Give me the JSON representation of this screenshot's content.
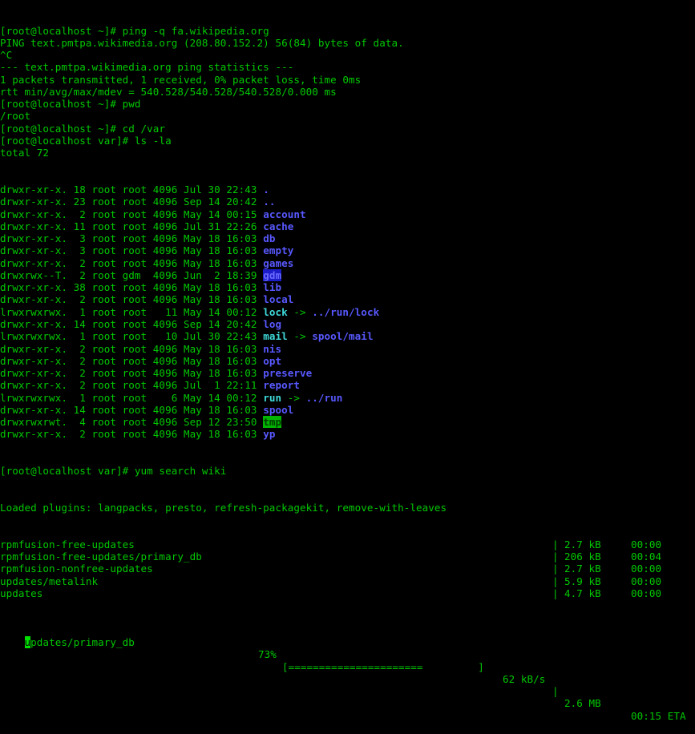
{
  "colors": {
    "background": "#000000",
    "text": "#00c800",
    "directory": "#5858ff",
    "symlink": "#3fd8d8",
    "sticky_dir_bg": "#00b400",
    "other_writable_bg": "#1c1cc8"
  },
  "history": [
    "[root@localhost ~]# ping -q fa.wikipedia.org",
    "PING text.pmtpa.wikimedia.org (208.80.152.2) 56(84) bytes of data.",
    "^C",
    "--- text.pmtpa.wikimedia.org ping statistics ---",
    "1 packets transmitted, 1 received, 0% packet loss, time 0ms",
    "rtt min/avg/max/mdev = 540.528/540.528/540.528/0.000 ms",
    "[root@localhost ~]# pwd",
    "/root",
    "[root@localhost ~]# cd /var",
    "[root@localhost var]# ls -la",
    "total 72"
  ],
  "listing": [
    {
      "meta": "drwxr-xr-x. 18 root root 4096 Jul 30 22:43 ",
      "name": ".",
      "type": "dir"
    },
    {
      "meta": "drwxr-xr-x. 23 root root 4096 Sep 14 20:42 ",
      "name": "..",
      "type": "dir"
    },
    {
      "meta": "drwxr-xr-x.  2 root root 4096 May 14 00:15 ",
      "name": "account",
      "type": "dir"
    },
    {
      "meta": "drwxr-xr-x. 11 root root 4096 Jul 31 22:26 ",
      "name": "cache",
      "type": "dir"
    },
    {
      "meta": "drwxr-xr-x.  3 root root 4096 May 18 16:03 ",
      "name": "db",
      "type": "dir"
    },
    {
      "meta": "drwxr-xr-x.  3 root root 4096 May 18 16:03 ",
      "name": "empty",
      "type": "dir"
    },
    {
      "meta": "drwxr-xr-x.  2 root root 4096 May 18 16:03 ",
      "name": "games",
      "type": "dir"
    },
    {
      "meta": "drwxrwx--T.  2 root gdm  4096 Jun  2 18:39 ",
      "name": "gdm",
      "type": "other-writable"
    },
    {
      "meta": "drwxr-xr-x. 38 root root 4096 May 18 16:03 ",
      "name": "lib",
      "type": "dir"
    },
    {
      "meta": "drwxr-xr-x.  2 root root 4096 May 18 16:03 ",
      "name": "local",
      "type": "dir"
    },
    {
      "meta": "lrwxrwxrwx.  1 root root   11 May 14 00:12 ",
      "name": "lock",
      "type": "link",
      "arrow": " -> ",
      "target": "../run/lock"
    },
    {
      "meta": "drwxr-xr-x. 14 root root 4096 Sep 14 20:42 ",
      "name": "log",
      "type": "dir"
    },
    {
      "meta": "lrwxrwxrwx.  1 root root   10 Jul 30 22:43 ",
      "name": "mail",
      "type": "link",
      "arrow": " -> ",
      "target": "spool/mail"
    },
    {
      "meta": "drwxr-xr-x.  2 root root 4096 May 18 16:03 ",
      "name": "nis",
      "type": "dir"
    },
    {
      "meta": "drwxr-xr-x.  2 root root 4096 May 18 16:03 ",
      "name": "opt",
      "type": "dir"
    },
    {
      "meta": "drwxr-xr-x.  2 root root 4096 May 18 16:03 ",
      "name": "preserve",
      "type": "dir"
    },
    {
      "meta": "drwxr-xr-x.  2 root root 4096 Jul  1 22:11 ",
      "name": "report",
      "type": "dir"
    },
    {
      "meta": "lrwxrwxrwx.  1 root root    6 May 14 00:12 ",
      "name": "run",
      "type": "link",
      "arrow": " -> ",
      "target": "../run"
    },
    {
      "meta": "drwxr-xr-x. 14 root root 4096 May 18 16:03 ",
      "name": "spool",
      "type": "dir"
    },
    {
      "meta": "drwxrwxrwt.  4 root root 4096 Sep 12 23:50 ",
      "name": "tmp",
      "type": "sticky"
    },
    {
      "meta": "drwxr-xr-x.  2 root root 4096 May 18 16:03 ",
      "name": "yp",
      "type": "dir"
    }
  ],
  "yum": {
    "command": "[root@localhost var]# yum search wiki",
    "plugins": "Loaded plugins: langpacks, presto, refresh-packagekit, remove-with-leaves",
    "repos": [
      {
        "name": "rpmfusion-free-updates",
        "size": "2.7 kB",
        "time": "00:00"
      },
      {
        "name": "rpmfusion-free-updates/primary_db",
        "size": "206 kB",
        "time": "00:04"
      },
      {
        "name": "rpmfusion-nonfree-updates",
        "size": "2.7 kB",
        "time": "00:00"
      },
      {
        "name": "updates/metalink",
        "size": "5.9 kB",
        "time": "00:00"
      },
      {
        "name": "updates",
        "size": "4.7 kB",
        "time": "00:00"
      }
    ],
    "progress": {
      "cursor_char": "u",
      "name_rest": "pdates/primary_db",
      "percent_label": "73%",
      "percent": 73,
      "bar": "[======================         ]",
      "rate": "62 kB/s",
      "size": "2.6 MB",
      "time": "00:15 ETA"
    },
    "separator": "|"
  }
}
